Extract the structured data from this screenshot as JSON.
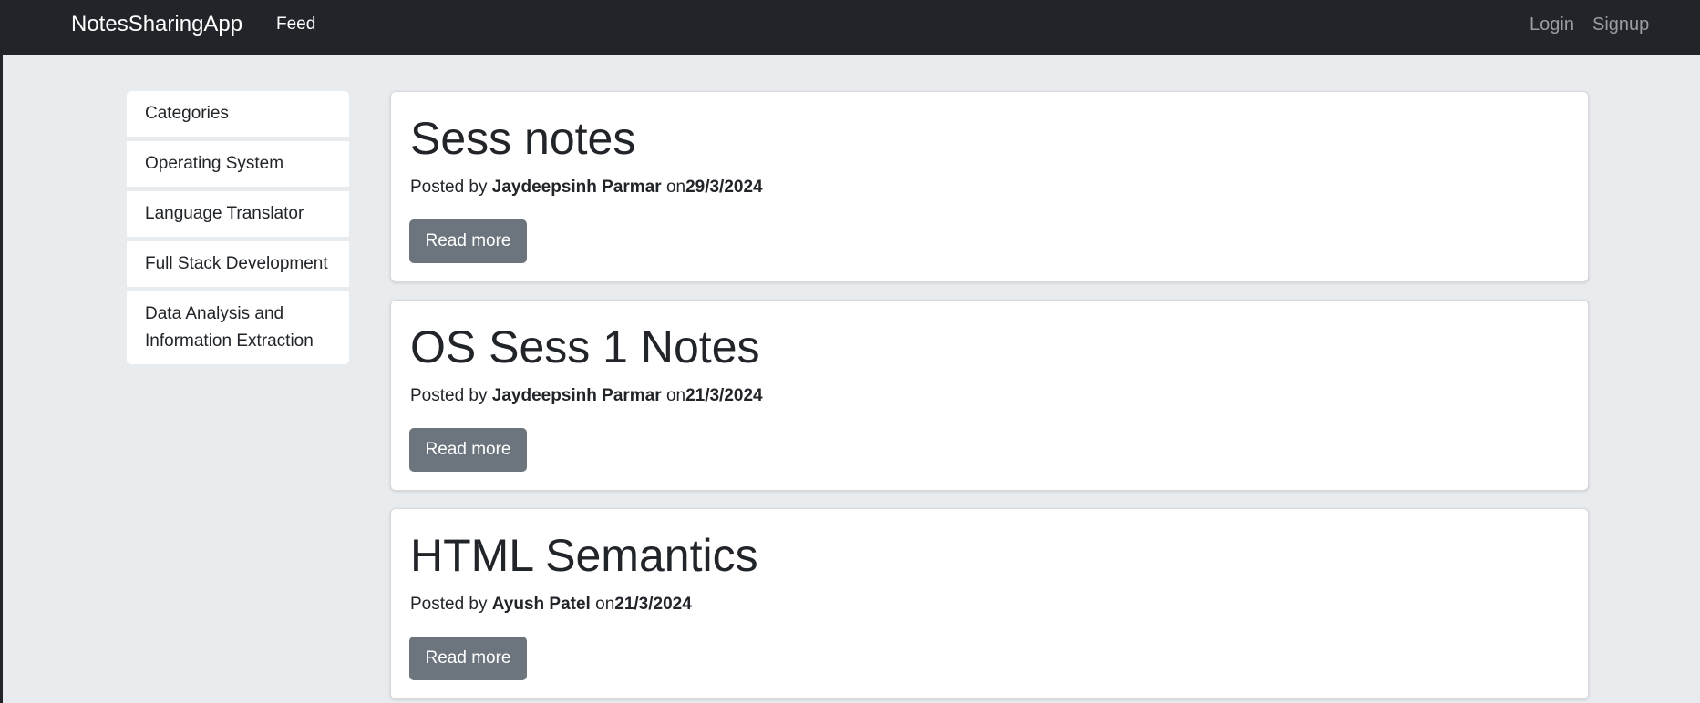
{
  "navbar": {
    "brand": "NotesSharingApp",
    "feed_label": "Feed",
    "login_label": "Login",
    "signup_label": "Signup"
  },
  "sidebar": {
    "items": [
      {
        "label": "Categories"
      },
      {
        "label": "Operating System"
      },
      {
        "label": "Language Translator"
      },
      {
        "label": "Full Stack Development"
      },
      {
        "label": "Data Analysis and Information Extraction"
      }
    ]
  },
  "posts": [
    {
      "title": "Sess notes",
      "posted_by_prefix": "Posted by",
      "author": "Jaydeepsinh Parmar",
      "on_label": "on",
      "date": "29/3/2024",
      "button_label": "Read more"
    },
    {
      "title": "OS Sess 1 Notes",
      "posted_by_prefix": "Posted by",
      "author": "Jaydeepsinh Parmar",
      "on_label": "on",
      "date": "21/3/2024",
      "button_label": "Read more"
    },
    {
      "title": "HTML Semantics",
      "posted_by_prefix": "Posted by",
      "author": "Ayush Patel",
      "on_label": "on",
      "date": "21/3/2024",
      "button_label": "Read more"
    }
  ],
  "colors": {
    "navbar_bg": "#212529",
    "page_bg": "#e9ecef",
    "button_bg": "#6c757d"
  }
}
